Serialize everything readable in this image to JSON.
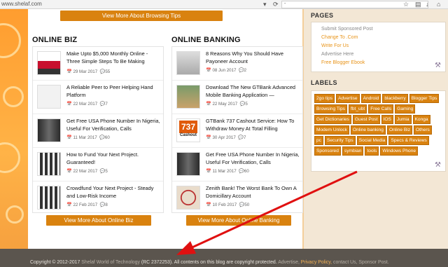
{
  "browser": {
    "url": "www.shelaf.com",
    "search_text": "-"
  },
  "top_button": {
    "label": "View More About Browsing Tips"
  },
  "online_biz": {
    "title": "ONLINE BIZ",
    "posts": [
      {
        "title": "Make Upto $5,000 Monthly Online - Three Simple Steps To Be Making",
        "date": "29 Mar 2017",
        "comments": "55"
      },
      {
        "title": "A Reliable Peer to Peer Helping Hand Platform",
        "date": "22 Mar 2017",
        "comments": "7"
      },
      {
        "title": "Get Free USA Phone Number In Nigeria, Useful For Verification, Calls",
        "date": "11 Mar 2017",
        "comments": "60"
      },
      {
        "title": "How to Fund Your Next Project. Guaranteed!",
        "date": "22 Mar 2017",
        "comments": "5"
      },
      {
        "title": "Crowdfund Your Next Project - Steady and Low-Risk Income",
        "date": "22 Feb 2017",
        "comments": "8"
      }
    ],
    "button_label": "View More About Online Biz"
  },
  "online_banking": {
    "title": "ONLINE BANKING",
    "posts": [
      {
        "title": "8 Reasons Why You Should Have Payoneer Account",
        "date": "08 Jun 2017",
        "comments": "2"
      },
      {
        "title": "Download The New GTBank Advanced Mobile Banking Application —",
        "date": "22 May 2017",
        "comments": "5"
      },
      {
        "title": "GTBank 737 Cashout Service: How To Withdraw Money At Total Filling",
        "date": "30 Apr 2017",
        "comments": "7"
      },
      {
        "title": "Get Free USA Phone Number In Nigeria, Useful For Verification, Calls",
        "date": "11 Mar 2017",
        "comments": "60"
      },
      {
        "title": "Zenith Bank! The Worst Bank To Own A Domicillary Account",
        "date": "10 Feb 2017",
        "comments": "50"
      }
    ],
    "button_label": "View More About Online Banking",
    "thumb_737": {
      "number": "737",
      "caption": "Cashout"
    }
  },
  "sidebar": {
    "pages_title": "PAGES",
    "pages": [
      {
        "label": "Submit Sponsored Post",
        "color": "#888888"
      },
      {
        "label": "Change To .Com",
        "color": "#e8941a"
      },
      {
        "label": "Write For Us",
        "color": "#e8941a"
      },
      {
        "label": "Advertise Here",
        "color": "#888888"
      },
      {
        "label": "Free Blogger Ebook",
        "color": "#e8941a"
      }
    ],
    "labels_title": "LABELS",
    "labels": [
      "2go tips",
      "Advertise",
      "Android",
      "blackberry",
      "Blogger Tips",
      "Browsing Tips",
      "fbt_ubt",
      "Free Calls",
      "Gaming",
      "Get Dictionaries",
      "Guest Post",
      "IOS",
      "Jumia",
      "Konga",
      "Modem Unlock",
      "Online banking",
      "Online Biz",
      "Others",
      "pc",
      "Security Tips",
      "Social Media",
      "Specs & Reviews",
      "Sponsored",
      "symbian",
      "tools",
      "Windows Phone"
    ]
  },
  "footer": {
    "copyright": "Copyright © 2012-2017",
    "site": "Shelaf World of Technology",
    "rc": "(RC 2372253).",
    "rights": "All contents on this blog are copyright protected.",
    "advertise": "Advertise,",
    "privacy": "Privacy Policy,",
    "contact": "contact Us,",
    "sponsor": "Sponsor Post."
  },
  "colors": {
    "accent": "#d9820f",
    "footer_bg": "#5b554e",
    "arrow": "#e01010"
  }
}
